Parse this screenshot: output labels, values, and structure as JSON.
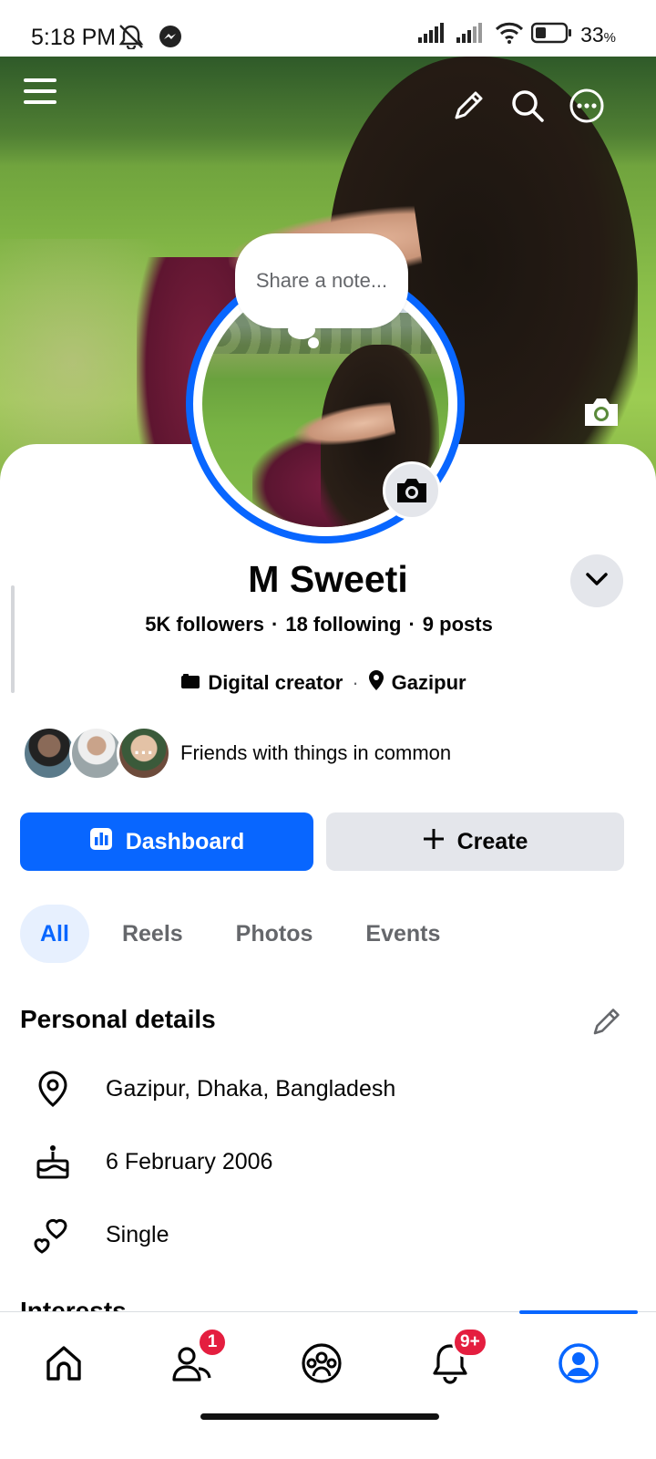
{
  "status_bar": {
    "time": "5:18 PM",
    "battery": "33",
    "battery_unit": "%",
    "icons": [
      "mute-icon",
      "messenger-icon",
      "signal-icon",
      "signal-icon",
      "wifi-icon",
      "battery-icon"
    ]
  },
  "cover": {
    "icons": [
      "menu-icon",
      "pencil-icon",
      "search-icon",
      "more-icon",
      "camera-icon"
    ]
  },
  "note": {
    "placeholder": "Share a note..."
  },
  "profile": {
    "name": "M Sweeti",
    "followers": "5K followers",
    "following": "18 following",
    "posts": "9 posts",
    "category": "Digital creator",
    "location": "Gazipur",
    "friends_text": "Friends with things in common"
  },
  "actions": {
    "dashboard_label": "Dashboard",
    "create_label": "Create"
  },
  "tabs": [
    {
      "label": "All",
      "active": true
    },
    {
      "label": "Reels",
      "active": false
    },
    {
      "label": "Photos",
      "active": false
    },
    {
      "label": "Events",
      "active": false
    }
  ],
  "personal_details": {
    "title": "Personal details",
    "items": [
      {
        "icon": "location-icon",
        "text": "Gazipur, Dhaka, Bangladesh"
      },
      {
        "icon": "birthday-cake-icon",
        "text": "6 February 2006"
      },
      {
        "icon": "relationship-heart-icon",
        "text": "Single"
      }
    ]
  },
  "next_section": {
    "title": "Interests"
  },
  "bottom_nav": {
    "items": [
      "home-icon",
      "friends-icon",
      "groups-icon",
      "notifications-icon",
      "profile-icon"
    ],
    "friends_badge": "1",
    "notifications_badge": "9+",
    "active": "profile-icon"
  },
  "colors": {
    "accent": "#0866ff",
    "secondary_button": "#e4e6eb",
    "badge": "#e41e3f",
    "muted_text": "#65676b"
  }
}
